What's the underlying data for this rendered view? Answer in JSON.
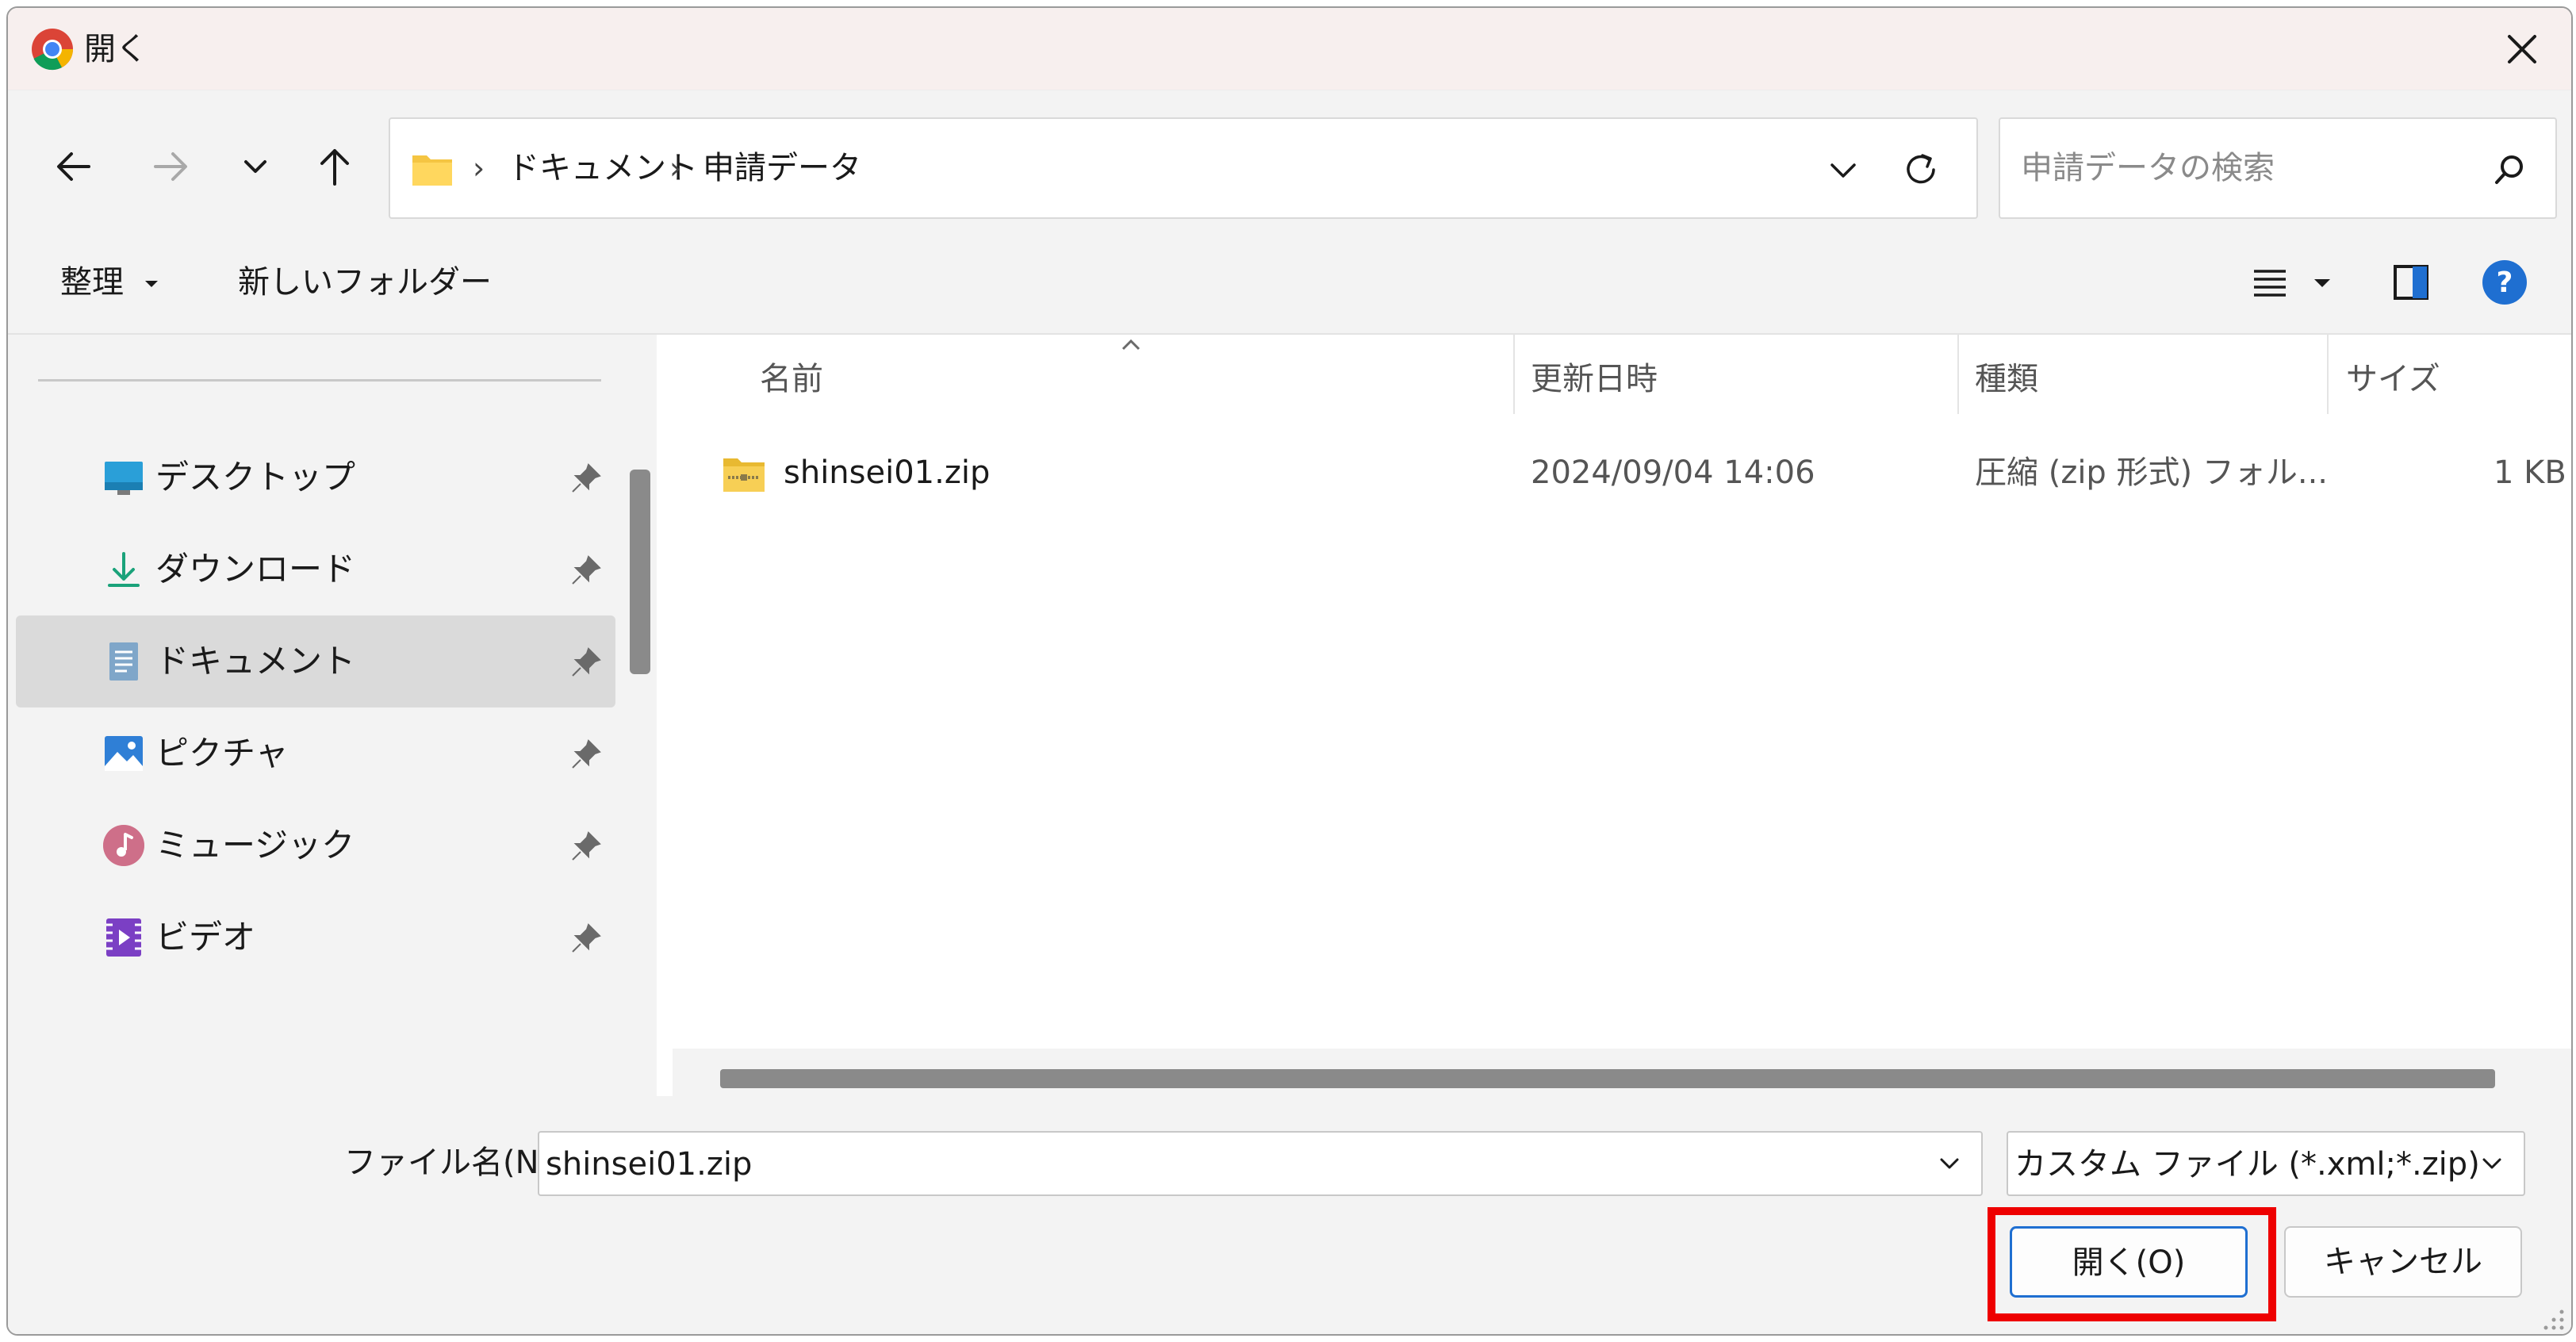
{
  "window": {
    "title": "開く",
    "app_icon": "chrome-icon",
    "close_icon": "close-icon"
  },
  "nav": {
    "back_icon": "arrow-left-icon",
    "forward_icon": "arrow-right-icon",
    "recent_icon": "chevron-down-icon",
    "up_icon": "arrow-up-icon",
    "breadcrumb": [
      "ドキュメント",
      "申請データ"
    ],
    "breadcrumb_separator": "›",
    "search_placeholder": "申請データの検索"
  },
  "toolbar": {
    "organize_label": "整理",
    "new_folder_label": "新しいフォルダー",
    "view_icon": "list-view-icon",
    "preview_icon": "preview-pane-icon",
    "help_icon": "help-icon"
  },
  "sidebar": {
    "items": [
      {
        "label": "デスクトップ",
        "icon": "desktop-icon",
        "pinned": true,
        "selected": false
      },
      {
        "label": "ダウンロード",
        "icon": "download-icon",
        "pinned": true,
        "selected": false
      },
      {
        "label": "ドキュメント",
        "icon": "document-icon",
        "pinned": true,
        "selected": true
      },
      {
        "label": "ピクチャ",
        "icon": "pictures-icon",
        "pinned": true,
        "selected": false
      },
      {
        "label": "ミュージック",
        "icon": "music-icon",
        "pinned": true,
        "selected": false
      },
      {
        "label": "ビデオ",
        "icon": "video-icon",
        "pinned": true,
        "selected": false
      }
    ]
  },
  "filelist": {
    "columns": [
      "名前",
      "更新日時",
      "種類",
      "サイズ"
    ],
    "rows": [
      {
        "name": "shinsei01.zip",
        "modified": "2024/09/04 14:06",
        "type": "圧縮 (zip 形式) フォル...",
        "size": "1 KB",
        "icon": "zip-folder-icon"
      }
    ]
  },
  "footer": {
    "filename_label": "ファイル名(N):",
    "filename_value": "shinsei01.zip",
    "filter_value": "カスタム ファイル (*.xml;*.zip)",
    "open_label": "開く(O)",
    "cancel_label": "キャンセル"
  },
  "colors": {
    "accent": "#1f6fd1",
    "highlight": "#ee0000",
    "titlebar": "#f7efee",
    "panel": "#f3f3f3"
  }
}
